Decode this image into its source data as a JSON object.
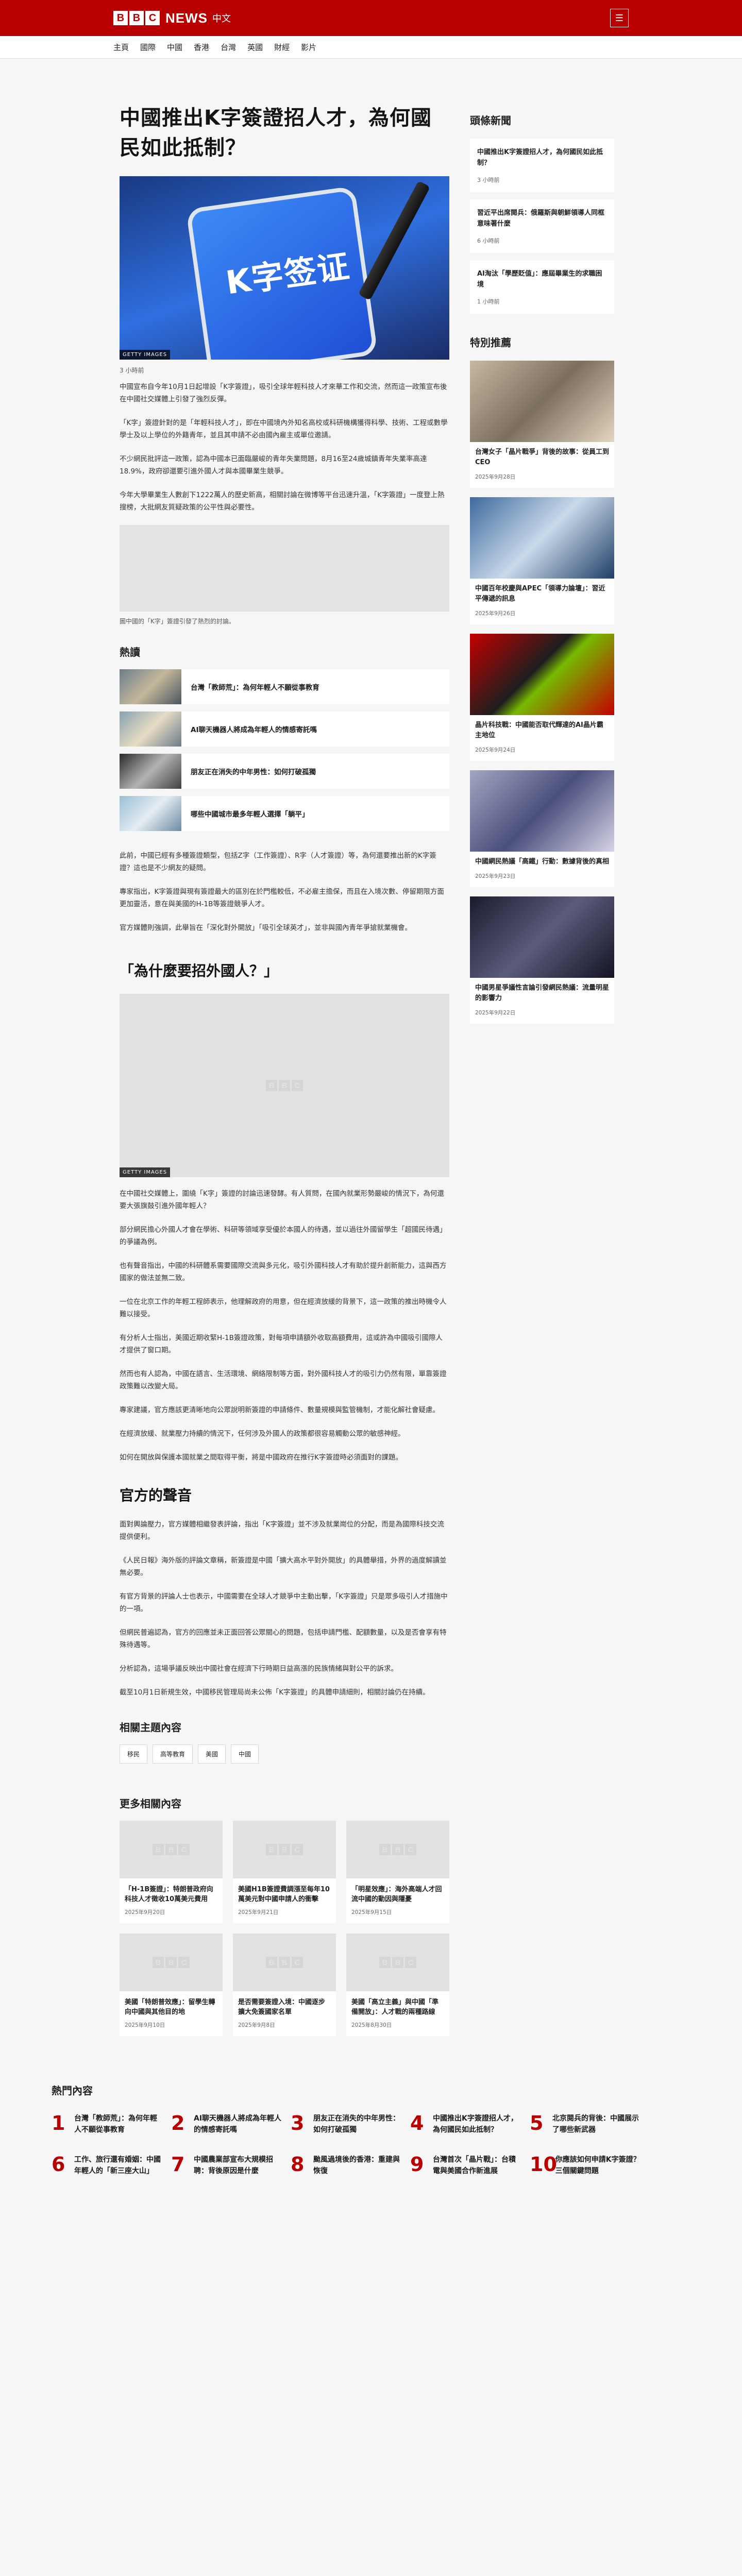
{
  "header": {
    "logo_letters": [
      "B",
      "B",
      "C"
    ],
    "brand": "NEWS",
    "lang": "中文",
    "nav": [
      "主頁",
      "國際",
      "中國",
      "香港",
      "台灣",
      "英國",
      "財經",
      "影片"
    ]
  },
  "article": {
    "headline": "中國推出K字簽證招人才，為何國民如此抵制？",
    "hero_text": "K字签证",
    "hero_credit": "GETTY IMAGES",
    "date": "3 小時前",
    "paragraphs_a": [
      "中國宣布自今年10月1日起增設「K字簽證」，吸引全球年輕科技人才來華工作和交流，然而這一政策宣布後在中國社交媒體上引發了強烈反彈。",
      "「K字」簽證針對的是「年輕科技人才」，即在中國境內外知名高校或科研機構獲得科學、技術、工程或數學學士及以上學位的外籍青年，並且其申請不必由國內雇主或單位邀請。",
      "不少網民批評這一政策，認為中國本已面臨嚴峻的青年失業問題，8月16至24歲城鎮青年失業率高達18.9%，政府卻還要引進外國人才與本國畢業生競爭。",
      "今年大學畢業生人數創下1222萬人的歷史新高，相關討論在微博等平台迅速升溫，「K字簽證」一度登上熱搜榜，大批網友質疑政策的公平性與必要性。"
    ],
    "image_caption": "圖中國的「K字」簽證引發了熱烈的討論。",
    "hot_title": "熱讀",
    "hot_items": [
      "台灣「教師荒」：為何年輕人不願從事教育",
      "AI聊天機器人將成為年輕人的情感寄託嗎",
      "朋友正在消失的中年男性：如何打破孤獨",
      "哪些中國城市最多年輕人選擇「躺平」"
    ],
    "paragraphs_b": [
      "此前，中國已經有多種簽證類型，包括Z字（工作簽證）、R字（人才簽證）等，為何還要推出新的K字簽證？這也是不少網友的疑問。",
      "專家指出，K字簽證與現有簽證最大的區別在於門檻較低，不必雇主擔保，而且在入境次數、停留期限方面更加靈活，意在與美國的H-1B等簽證競爭人才。",
      "官方媒體則強調，此舉旨在「深化對外開放」「吸引全球英才」，並非與國內青年爭搶就業機會。"
    ],
    "section1": "「為什麼要招外國人？」",
    "section1_credit": "GETTY IMAGES",
    "paragraphs_c": [
      "在中國社交媒體上，圍繞「K字」簽證的討論迅速發酵。有人質問，在國內就業形勢嚴峻的情況下，為何還要大張旗鼓引進外國年輕人？",
      "部分網民擔心外國人才會在學術、科研等領域享受優於本國人的待遇，並以過往外國留學生「超國民待遇」的爭議為例。",
      "也有聲音指出，中國的科研體系需要國際交流與多元化，吸引外國科技人才有助於提升創新能力，這與西方國家的做法並無二致。",
      "一位在北京工作的年輕工程師表示，他理解政府的用意，但在經濟放緩的背景下，這一政策的推出時機令人難以接受。",
      "有分析人士指出，美國近期收緊H-1B簽證政策，對每項申請額外收取高額費用，這或許為中國吸引國際人才提供了窗口期。",
      "然而也有人認為，中國在語言、生活環境、網絡限制等方面，對外國科技人才的吸引力仍然有限，單靠簽證政策難以改變大局。",
      "專家建議，官方應該更清晰地向公眾說明新簽證的申請條件、數量規模與監管機制，才能化解社會疑慮。",
      "在經濟放緩、就業壓力持續的情況下，任何涉及外國人的政策都很容易觸動公眾的敏感神經。",
      "如何在開放與保護本國就業之間取得平衡，將是中國政府在推行K字簽證時必須面對的課題。"
    ],
    "section2": "官方的聲音",
    "paragraphs_d": [
      "面對輿論壓力，官方媒體相繼發表評論，指出「K字簽證」並不涉及就業崗位的分配，而是為國際科技交流提供便利。",
      "《人民日報》海外版的評論文章稱，新簽證是中國「擴大高水平對外開放」的具體舉措，外界的過度解讀並無必要。",
      "有官方背景的評論人士也表示，中國需要在全球人才競爭中主動出擊，「K字簽證」只是眾多吸引人才措施中的一項。",
      "但網民普遍認為，官方的回應並未正面回答公眾關心的問題，包括申請門檻、配額數量，以及是否會享有特殊待遇等。",
      "分析認為，這場爭議反映出中國社會在經濟下行時期日益高漲的民族情緒與對公平的訴求。",
      "截至10月1日新規生效，中國移民管理局尚未公佈「K字簽證」的具體申請細則，相關討論仍在持續。"
    ],
    "topic_title": "相關主題內容",
    "tags": [
      "移民",
      "高等教育",
      "美國",
      "中國"
    ],
    "more_title": "更多相關內容",
    "more_cards": [
      {
        "title": "「H-1B簽證」：特朗普政府向科技人才徵收10萬美元費用",
        "date": "2025年9月20日"
      },
      {
        "title": "美國H1B簽證費調漲至每年10萬美元對中國申請人的衝擊",
        "date": "2025年9月21日"
      },
      {
        "title": "「明星效應」：海外高端人才回流中國的動因與隱憂",
        "date": "2025年9月15日"
      },
      {
        "title": "美國「特朗普效應」：留學生轉向中國與其他目的地",
        "date": "2025年9月10日"
      },
      {
        "title": "是否需要簽證入境：中國逐步擴大免簽國家名單",
        "date": "2025年9月8日"
      },
      {
        "title": "美國「高立主義」與中國「準備開放」：人才戰的兩種路線",
        "date": "2025年8月30日"
      }
    ]
  },
  "aside": {
    "top_title": "頭條新聞",
    "top_stories": [
      {
        "title": "中國推出K字簽證招人才，為何國民如此抵制？",
        "date": "3 小時前"
      },
      {
        "title": "習近平出席閱兵：俄羅斯與朝鮮領導人同框意味著什麼",
        "date": "6 小時前"
      },
      {
        "title": "AI淘汰「學歷貶值」：應屆畢業生的求職困境",
        "date": "1 小時前"
      }
    ],
    "feature_title": "特別推薦",
    "features": [
      {
        "title": "台灣女子「晶片戰爭」背後的故事：從員工到CEO",
        "date": "2025年9月28日"
      },
      {
        "title": "中國百年校慶與APEC「領導力論壇」：習近平傳遞的訊息",
        "date": "2025年9月26日"
      },
      {
        "title": "晶片科技戰：中國能否取代輝達的AI晶片霸主地位",
        "date": "2025年9月24日"
      },
      {
        "title": "中國網民熱議「高鐵」行動：數據背後的真相",
        "date": "2025年9月23日"
      },
      {
        "title": "中國男星爭議性言論引發網民熱議：流量明星的影響力",
        "date": "2025年9月22日"
      }
    ]
  },
  "popular": {
    "title": "熱門內容",
    "items": [
      "台灣「教師荒」：為何年輕人不願從事教育",
      "AI聊天機器人將成為年輕人的情感寄託嗎",
      "朋友正在消失的中年男性：如何打破孤獨",
      "中國推出K字簽證招人才，為何國民如此抵制？",
      "北京閱兵的背後：中國展示了哪些新武器",
      "工作、旅行還有婚姻：中國年輕人的「新三座大山」",
      "中國農業部宣布大規模招聘：背後原因是什麼",
      "颱風過境後的香港：重建與恢復",
      "台灣首次「晶片戰」：台積電與美國合作新進展",
      "你應該如何申請K字簽證？三個關鍵問題"
    ]
  }
}
